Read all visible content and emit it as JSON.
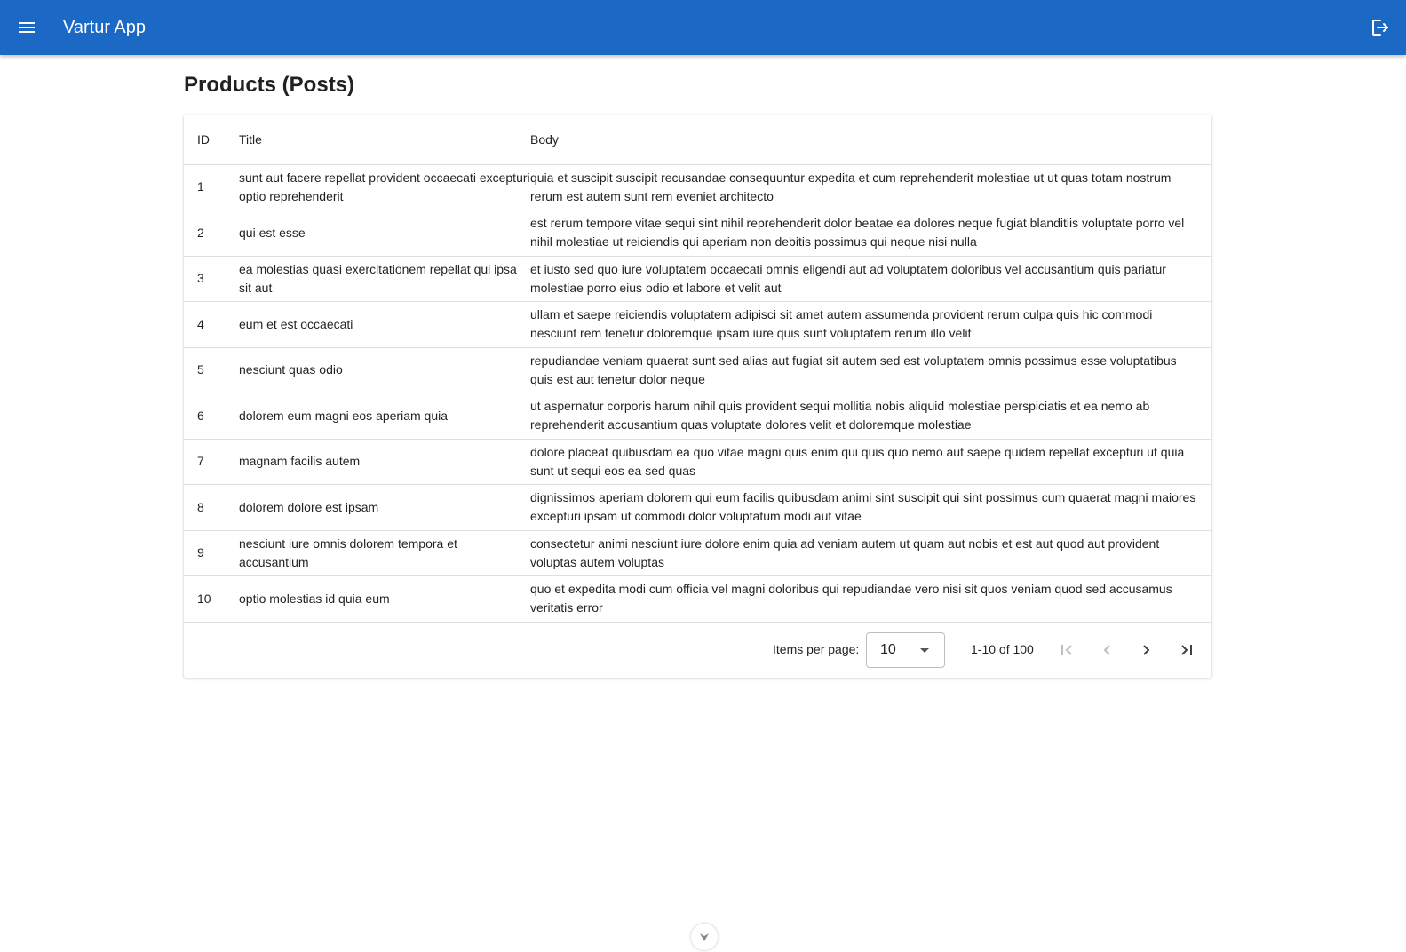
{
  "app": {
    "title": "Vartur App",
    "menu_icon": "menu-icon",
    "logout_icon": "logout-icon"
  },
  "page": {
    "title": "Products (Posts)"
  },
  "table": {
    "columns": [
      "ID",
      "Title",
      "Body"
    ],
    "rows": [
      {
        "id": "1",
        "title": "sunt aut facere repellat provident occaecati excepturi optio reprehenderit",
        "body": "quia et suscipit suscipit recusandae consequuntur expedita et cum reprehenderit molestiae ut ut quas totam nostrum rerum est autem sunt rem eveniet architecto"
      },
      {
        "id": "2",
        "title": "qui est esse",
        "body": "est rerum tempore vitae sequi sint nihil reprehenderit dolor beatae ea dolores neque fugiat blanditiis voluptate porro vel nihil molestiae ut reiciendis qui aperiam non debitis possimus qui neque nisi nulla"
      },
      {
        "id": "3",
        "title": "ea molestias quasi exercitationem repellat qui ipsa sit aut",
        "body": "et iusto sed quo iure voluptatem occaecati omnis eligendi aut ad voluptatem doloribus vel accusantium quis pariatur molestiae porro eius odio et labore et velit aut"
      },
      {
        "id": "4",
        "title": "eum et est occaecati",
        "body": "ullam et saepe reiciendis voluptatem adipisci sit amet autem assumenda provident rerum culpa quis hic commodi nesciunt rem tenetur doloremque ipsam iure quis sunt voluptatem rerum illo velit"
      },
      {
        "id": "5",
        "title": "nesciunt quas odio",
        "body": "repudiandae veniam quaerat sunt sed alias aut fugiat sit autem sed est voluptatem omnis possimus esse voluptatibus quis est aut tenetur dolor neque"
      },
      {
        "id": "6",
        "title": "dolorem eum magni eos aperiam quia",
        "body": "ut aspernatur corporis harum nihil quis provident sequi mollitia nobis aliquid molestiae perspiciatis et ea nemo ab reprehenderit accusantium quas voluptate dolores velit et doloremque molestiae"
      },
      {
        "id": "7",
        "title": "magnam facilis autem",
        "body": "dolore placeat quibusdam ea quo vitae magni quis enim qui quis quo nemo aut saepe quidem repellat excepturi ut quia sunt ut sequi eos ea sed quas"
      },
      {
        "id": "8",
        "title": "dolorem dolore est ipsam",
        "body": "dignissimos aperiam dolorem qui eum facilis quibusdam animi sint suscipit qui sint possimus cum quaerat magni maiores excepturi ipsam ut commodi dolor voluptatum modi aut vitae"
      },
      {
        "id": "9",
        "title": "nesciunt iure omnis dolorem tempora et accusantium",
        "body": "consectetur animi nesciunt iure dolore enim quia ad veniam autem ut quam aut nobis et est aut quod aut provident voluptas autem voluptas"
      },
      {
        "id": "10",
        "title": "optio molestias id quia eum",
        "body": "quo et expedita modi cum officia vel magni doloribus qui repudiandae vero nisi sit quos veniam quod sed accusamus veritatis error"
      }
    ]
  },
  "paginator": {
    "items_per_page_label": "Items per page:",
    "items_per_page_value": "10",
    "range_label": "1-10 of 100",
    "icons": [
      "first-page-icon",
      "previous-page-icon",
      "next-page-icon",
      "last-page-icon"
    ]
  },
  "colors": {
    "primary": "#1b69c4",
    "divider": "#e0e0e0",
    "text": "#212121"
  }
}
